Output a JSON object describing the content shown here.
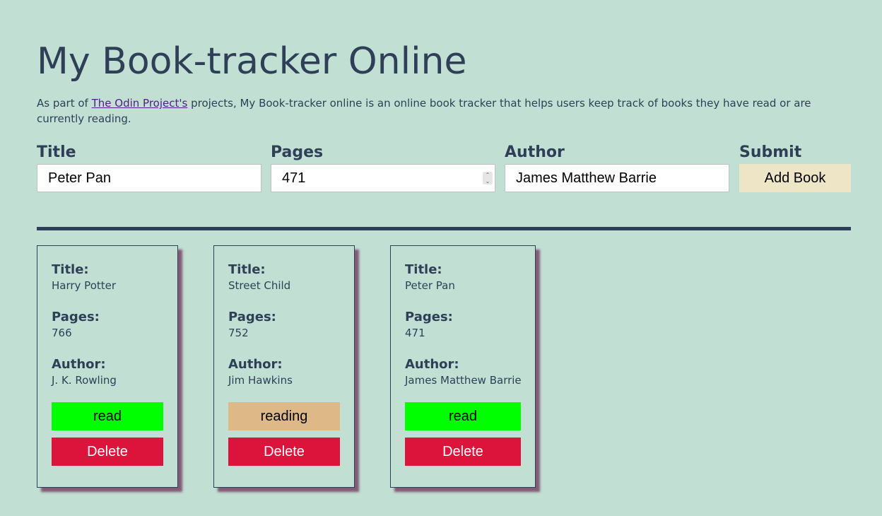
{
  "header": {
    "title": "My Book-tracker Online"
  },
  "intro": {
    "prefix": "As part of ",
    "link_text": "The Odin Project's",
    "suffix": " projects, My Book-tracker online is an online book tracker that helps users keep track of books they have read or are currently reading."
  },
  "form": {
    "title_label": "Title",
    "title_value": "Peter Pan",
    "pages_label": "Pages",
    "pages_value": "471",
    "author_label": "Author",
    "author_value": "James Matthew Barrie",
    "submit_label": "Submit",
    "add_button": "Add Book"
  },
  "colors": {
    "background": "#c1dfd2",
    "text": "#2f3f57",
    "read": "#00ff00",
    "reading": "#deb887",
    "delete": "#dc143c",
    "add_button": "#ede5c6"
  },
  "cards": [
    {
      "title_label": "Title:",
      "title": "Harry Potter",
      "pages_label": "Pages:",
      "pages": "766",
      "author_label": "Author:",
      "author": "J. K. Rowling",
      "status": "read",
      "delete": "Delete"
    },
    {
      "title_label": "Title:",
      "title": "Street Child",
      "pages_label": "Pages:",
      "pages": "752",
      "author_label": "Author:",
      "author": "Jim Hawkins",
      "status": "reading",
      "delete": "Delete"
    },
    {
      "title_label": "Title:",
      "title": "Peter Pan",
      "pages_label": "Pages:",
      "pages": "471",
      "author_label": "Author:",
      "author": "James Matthew Barrie",
      "status": "read",
      "delete": "Delete"
    }
  ]
}
